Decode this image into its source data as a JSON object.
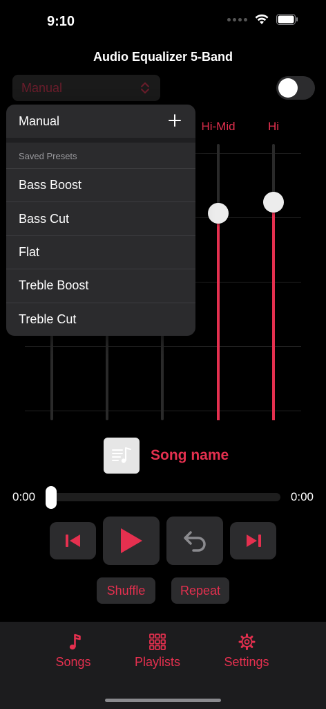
{
  "status_bar": {
    "time": "9:10"
  },
  "header": {
    "title": "Audio Equalizer 5-Band"
  },
  "preset_selector": {
    "selected": "Manual"
  },
  "equalizer": {
    "bands": [
      {
        "name": "",
        "level": 0.0
      },
      {
        "name": "",
        "level": 0.0
      },
      {
        "name": "",
        "level": 0.0
      },
      {
        "name": "Hi-Mid",
        "level": 0.75
      },
      {
        "name": "Hi",
        "level": 0.79
      }
    ]
  },
  "preset_menu": {
    "header": "Manual",
    "section_title": "Saved Presets",
    "items": [
      "Bass Boost",
      "Bass Cut",
      "Flat",
      "Treble Boost",
      "Treble Cut"
    ]
  },
  "player": {
    "song_name": "Song name",
    "time_elapsed": "0:00",
    "time_total": "0:00",
    "progress": 0.0,
    "shuffle_label": "Shuffle",
    "repeat_label": "Repeat"
  },
  "tabs": [
    {
      "label": "Songs",
      "icon": "music-note-icon"
    },
    {
      "label": "Playlists",
      "icon": "grid-icon"
    },
    {
      "label": "Settings",
      "icon": "gear-icon"
    }
  ],
  "colors": {
    "accent": "#e5304f",
    "background": "#000000",
    "surface": "#2c2c2e"
  }
}
